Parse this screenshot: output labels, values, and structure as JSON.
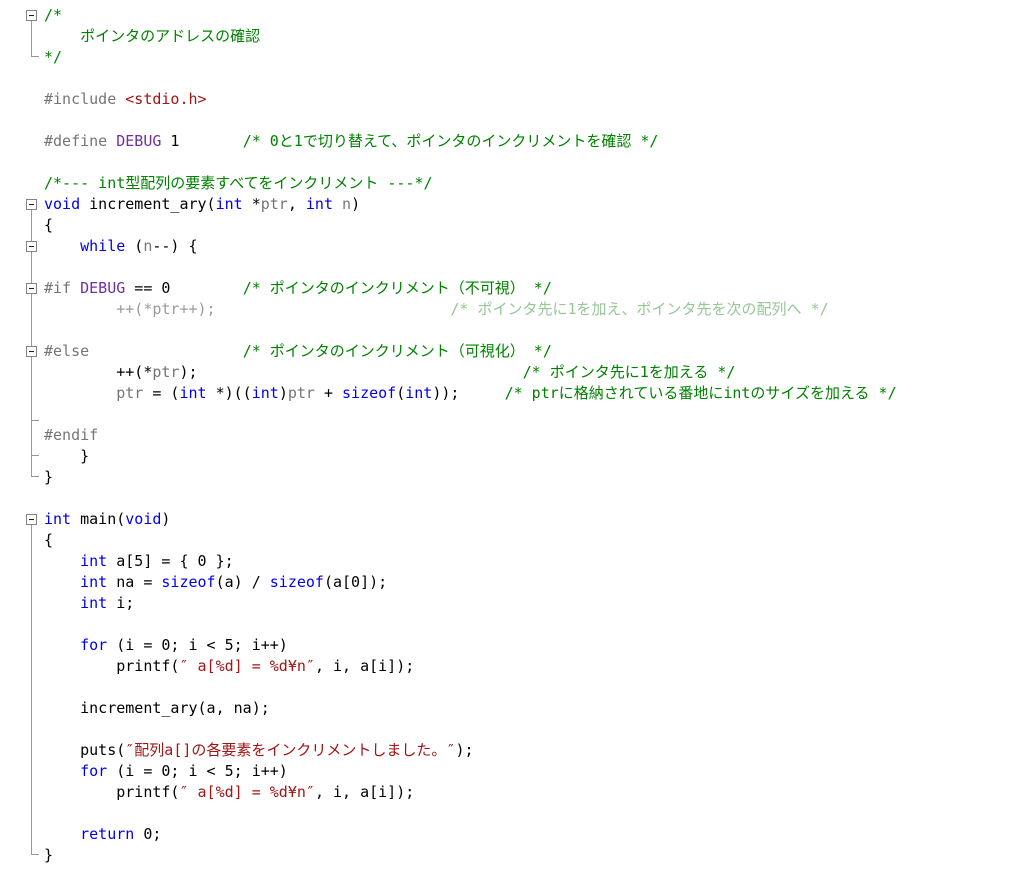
{
  "editor": {
    "description": "C source code viewport with code folding margin",
    "background": "#FFFFFF",
    "colors": {
      "keyword": "#0000EE",
      "comment": "#008200",
      "comment_inactive": "#95C795",
      "string": "#A31515",
      "macro": "#7030A0",
      "preprocessor": "#757575",
      "identifier": "#757575",
      "inactive_code": "#9B9B9B",
      "text": "#000000",
      "fold_line": "#989898",
      "fold_box_border": "#848484",
      "fold_minus": "#1E1E1E"
    },
    "lines": [
      {
        "n": 1,
        "fold": "boxBelow",
        "segments": [
          [
            "c",
            "/*"
          ]
        ]
      },
      {
        "n": 2,
        "fold": "line",
        "segments": [
          [
            "c",
            "    ポインタのアドレスの確認"
          ]
        ]
      },
      {
        "n": 3,
        "fold": "end",
        "segments": [
          [
            "c",
            "*/"
          ]
        ]
      },
      {
        "n": 4,
        "fold": "none",
        "segments": []
      },
      {
        "n": 5,
        "fold": "none",
        "segments": [
          [
            "p",
            "#include "
          ],
          [
            "s",
            "<stdio.h>"
          ]
        ]
      },
      {
        "n": 6,
        "fold": "none",
        "segments": []
      },
      {
        "n": 7,
        "fold": "none",
        "segments": [
          [
            "p",
            "#define "
          ],
          [
            "m",
            "DEBUG"
          ],
          [
            "t",
            " 1       "
          ],
          [
            "c",
            "/* 0と1で切り替えて、ポインタのインクリメントを確認 */"
          ]
        ]
      },
      {
        "n": 8,
        "fold": "none",
        "segments": []
      },
      {
        "n": 9,
        "fold": "none",
        "segments": [
          [
            "c",
            "/*--- int型配列の要素すべてをインクリメント ---*/"
          ]
        ]
      },
      {
        "n": 10,
        "fold": "boxBelow",
        "segments": [
          [
            "k",
            "void"
          ],
          [
            "t",
            " increment_ary("
          ],
          [
            "k",
            "int"
          ],
          [
            "t",
            " *"
          ],
          [
            "id",
            "ptr"
          ],
          [
            "t",
            ", "
          ],
          [
            "k",
            "int"
          ],
          [
            "t",
            " "
          ],
          [
            "id",
            "n"
          ],
          [
            "t",
            ")"
          ]
        ]
      },
      {
        "n": 11,
        "fold": "line",
        "segments": [
          [
            "t",
            "{"
          ]
        ]
      },
      {
        "n": 12,
        "fold": "boxBoth",
        "segments": [
          [
            "t",
            "    "
          ],
          [
            "k",
            "while"
          ],
          [
            "t",
            " ("
          ],
          [
            "id",
            "n"
          ],
          [
            "t",
            "--) {"
          ]
        ]
      },
      {
        "n": 13,
        "fold": "line",
        "segments": []
      },
      {
        "n": 14,
        "fold": "boxBoth",
        "segments": [
          [
            "p",
            "#if "
          ],
          [
            "m",
            "DEBUG"
          ],
          [
            "t",
            " == 0        "
          ],
          [
            "c",
            "/* ポインタのインクリメント（不可視） */"
          ]
        ]
      },
      {
        "n": 15,
        "fold": "line",
        "segments": [
          [
            "ic",
            "        ++(*ptr++);"
          ],
          [
            "t",
            "                          "
          ],
          [
            "ci",
            "/* ポインタ先に1を加え、ポインタ先を次の配列へ */"
          ]
        ]
      },
      {
        "n": 16,
        "fold": "line",
        "segments": []
      },
      {
        "n": 17,
        "fold": "boxBoth",
        "segments": [
          [
            "p",
            "#else"
          ],
          [
            "t",
            "                 "
          ],
          [
            "c",
            "/* ポインタのインクリメント（可視化） */"
          ]
        ]
      },
      {
        "n": 18,
        "fold": "line",
        "segments": [
          [
            "t",
            "        ++(*"
          ],
          [
            "id",
            "ptr"
          ],
          [
            "t",
            ");"
          ],
          [
            "t",
            "                                    "
          ],
          [
            "c",
            "/* ポインタ先に1を加える */"
          ]
        ]
      },
      {
        "n": 19,
        "fold": "line",
        "segments": [
          [
            "t",
            "        "
          ],
          [
            "id",
            "ptr"
          ],
          [
            "t",
            " = ("
          ],
          [
            "k",
            "int"
          ],
          [
            "t",
            " *)(("
          ],
          [
            "k",
            "int"
          ],
          [
            "t",
            ")"
          ],
          [
            "id",
            "ptr"
          ],
          [
            "t",
            " + "
          ],
          [
            "k",
            "sizeof"
          ],
          [
            "t",
            "("
          ],
          [
            "k",
            "int"
          ],
          [
            "t",
            "));     "
          ],
          [
            "c",
            "/* ptrに格納されている番地にintのサイズを加える */"
          ]
        ]
      },
      {
        "n": 20,
        "fold": "teeBottom",
        "segments": []
      },
      {
        "n": 21,
        "fold": "line",
        "segments": [
          [
            "p",
            "#endif"
          ]
        ]
      },
      {
        "n": 22,
        "fold": "tee",
        "segments": [
          [
            "t",
            "    }"
          ]
        ]
      },
      {
        "n": 23,
        "fold": "end",
        "segments": [
          [
            "t",
            "}"
          ]
        ]
      },
      {
        "n": 24,
        "fold": "none",
        "segments": []
      },
      {
        "n": 25,
        "fold": "boxBelow",
        "segments": [
          [
            "k",
            "int"
          ],
          [
            "t",
            " main("
          ],
          [
            "k",
            "void"
          ],
          [
            "t",
            ")"
          ]
        ]
      },
      {
        "n": 26,
        "fold": "line",
        "segments": [
          [
            "t",
            "{"
          ]
        ]
      },
      {
        "n": 27,
        "fold": "line",
        "segments": [
          [
            "t",
            "    "
          ],
          [
            "k",
            "int"
          ],
          [
            "t",
            " a[5] = { 0 };"
          ]
        ]
      },
      {
        "n": 28,
        "fold": "line",
        "segments": [
          [
            "t",
            "    "
          ],
          [
            "k",
            "int"
          ],
          [
            "t",
            " na = "
          ],
          [
            "k",
            "sizeof"
          ],
          [
            "t",
            "(a) / "
          ],
          [
            "k",
            "sizeof"
          ],
          [
            "t",
            "(a[0]);"
          ]
        ]
      },
      {
        "n": 29,
        "fold": "line",
        "segments": [
          [
            "t",
            "    "
          ],
          [
            "k",
            "int"
          ],
          [
            "t",
            " i;"
          ]
        ]
      },
      {
        "n": 30,
        "fold": "line",
        "segments": []
      },
      {
        "n": 31,
        "fold": "line",
        "segments": [
          [
            "t",
            "    "
          ],
          [
            "k",
            "for"
          ],
          [
            "t",
            " (i = 0; i < 5; i++)"
          ]
        ]
      },
      {
        "n": 32,
        "fold": "line",
        "segments": [
          [
            "t",
            "        printf("
          ],
          [
            "s",
            "″ a[%d] = %d¥n″"
          ],
          [
            "t",
            ", i, a[i]);"
          ]
        ]
      },
      {
        "n": 33,
        "fold": "line",
        "segments": []
      },
      {
        "n": 34,
        "fold": "line",
        "segments": [
          [
            "t",
            "    increment_ary(a, na);"
          ]
        ]
      },
      {
        "n": 35,
        "fold": "line",
        "segments": []
      },
      {
        "n": 36,
        "fold": "line",
        "segments": [
          [
            "t",
            "    puts("
          ],
          [
            "s",
            "″配列a[]の各要素をインクリメントしました。″"
          ],
          [
            "t",
            ");"
          ]
        ]
      },
      {
        "n": 37,
        "fold": "line",
        "segments": [
          [
            "t",
            "    "
          ],
          [
            "k",
            "for"
          ],
          [
            "t",
            " (i = 0; i < 5; i++)"
          ]
        ]
      },
      {
        "n": 38,
        "fold": "line",
        "segments": [
          [
            "t",
            "        printf("
          ],
          [
            "s",
            "″ a[%d] = %d¥n″"
          ],
          [
            "t",
            ", i, a[i]);"
          ]
        ]
      },
      {
        "n": 39,
        "fold": "line",
        "segments": []
      },
      {
        "n": 40,
        "fold": "line",
        "segments": [
          [
            "t",
            "    "
          ],
          [
            "k",
            "return"
          ],
          [
            "t",
            " 0;"
          ]
        ]
      },
      {
        "n": 41,
        "fold": "end",
        "segments": [
          [
            "t",
            "}"
          ]
        ]
      },
      {
        "n": 42,
        "fold": "none",
        "segments": []
      }
    ]
  }
}
